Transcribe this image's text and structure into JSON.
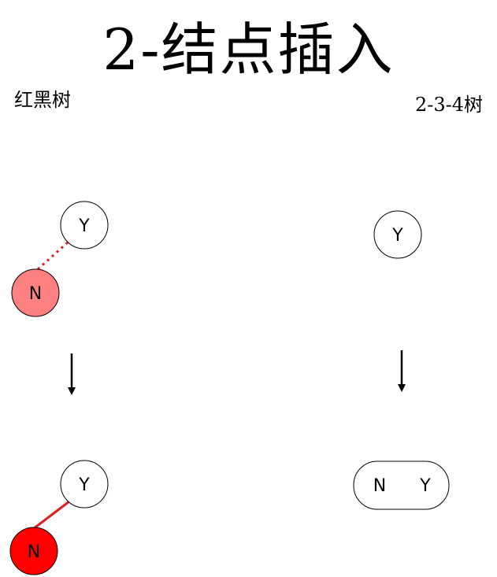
{
  "title": "2-结点插入",
  "left_label": "红黑树",
  "right_label": "2-3-4树",
  "nodes": {
    "rb_before_parent": "Y",
    "rb_before_child": "N",
    "rb_after_parent": "Y",
    "rb_after_child": "N",
    "t234_before": "Y",
    "t234_after_left": "N",
    "t234_after_right": "Y"
  },
  "colors": {
    "red_pending": "#ff8080",
    "red": "#ff0000",
    "red_link": "#e02020",
    "stroke": "#000000"
  }
}
